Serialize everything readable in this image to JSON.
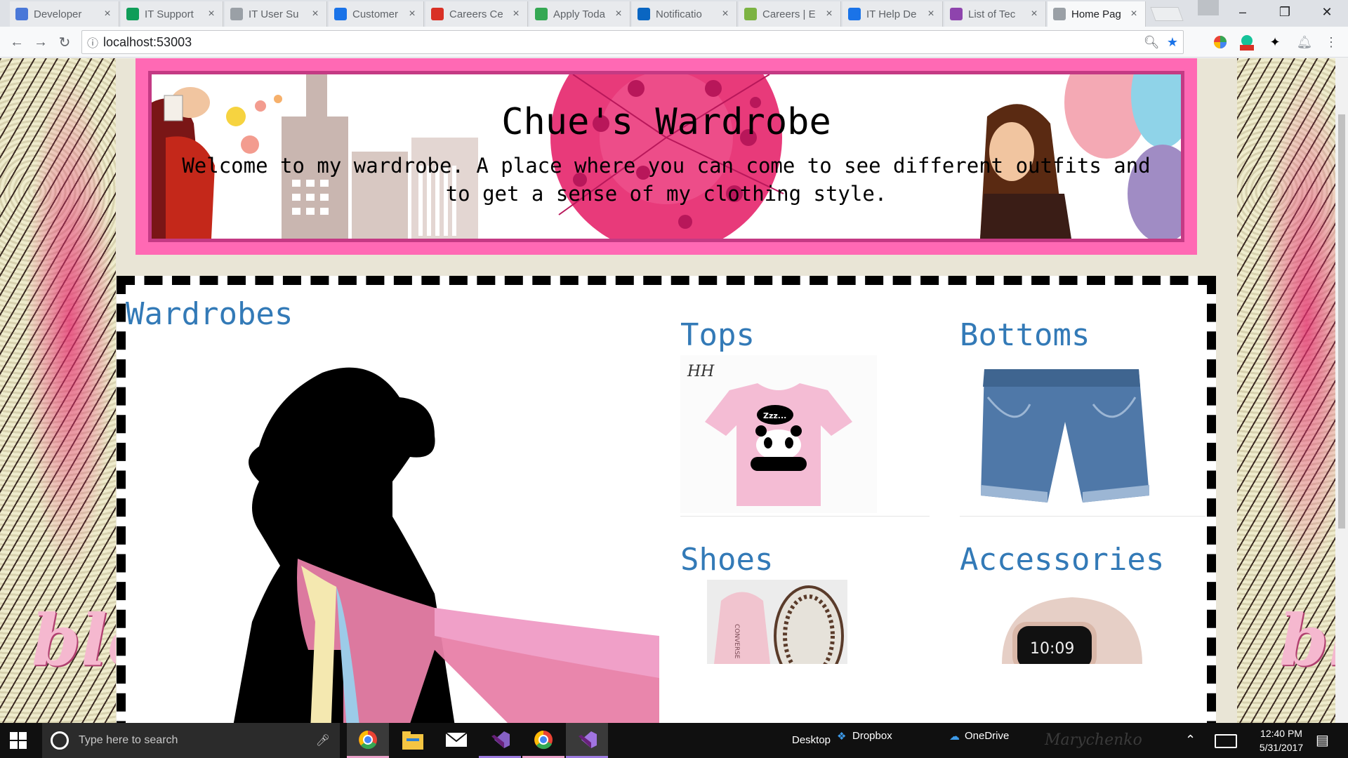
{
  "browser": {
    "tabs": [
      {
        "label": "Developer",
        "icon": "facebook-icon",
        "color": "#4a78d8"
      },
      {
        "label": "IT Support",
        "icon": "sheet-icon",
        "color": "#0f9d58"
      },
      {
        "label": "IT User Su",
        "icon": "document-icon",
        "color": "#9aa0a6"
      },
      {
        "label": "Customer",
        "icon": "checkbox-icon",
        "color": "#1a73e8"
      },
      {
        "label": "Careers Ce",
        "icon": "info-icon",
        "color": "#d93025"
      },
      {
        "label": "Apply Toda",
        "icon": "hyl-icon",
        "color": "#34a853"
      },
      {
        "label": "Notificatio",
        "icon": "linkedin-icon",
        "color": "#0a66c2"
      },
      {
        "label": "Careers | E",
        "icon": "pie-icon",
        "color": "#7cb342"
      },
      {
        "label": "IT Help De",
        "icon": "w-icon",
        "color": "#1a73e8"
      },
      {
        "label": "List of Tec",
        "icon": "bookmark-icon",
        "color": "#8e44ad"
      },
      {
        "label": "Home Pag",
        "icon": "page-icon",
        "color": "#9aa0a6"
      }
    ],
    "url": "localhost:53003"
  },
  "page": {
    "banner": {
      "title": "Chue's Wardrobe",
      "subtitle": "Welcome to my wardrobe. A place where you can come to see different outfits and to get a sense of my clothing style."
    },
    "wardrobes_heading": "Wardrobes",
    "categories": [
      {
        "label": "Tops"
      },
      {
        "label": "Bottoms"
      },
      {
        "label": "Shoes"
      },
      {
        "label": "Accessories"
      }
    ],
    "tee_logo": "HH",
    "tee_speech": "Zzz...",
    "shoe_text": "CONVERSE",
    "watch_time": "10:09",
    "side_text": "ble"
  },
  "taskbar": {
    "search_placeholder": "Type here to search",
    "desktop_label": "Desktop",
    "dropbox_label": "Dropbox",
    "onedrive_label": "OneDrive",
    "time": "12:40 PM",
    "date": "5/31/2017",
    "watermark": "Marychenko"
  },
  "colors": {
    "link": "#337ab7",
    "banner_border": "#ff69b4",
    "banner_inner": "#c43a84",
    "taskbar": "#101010"
  }
}
